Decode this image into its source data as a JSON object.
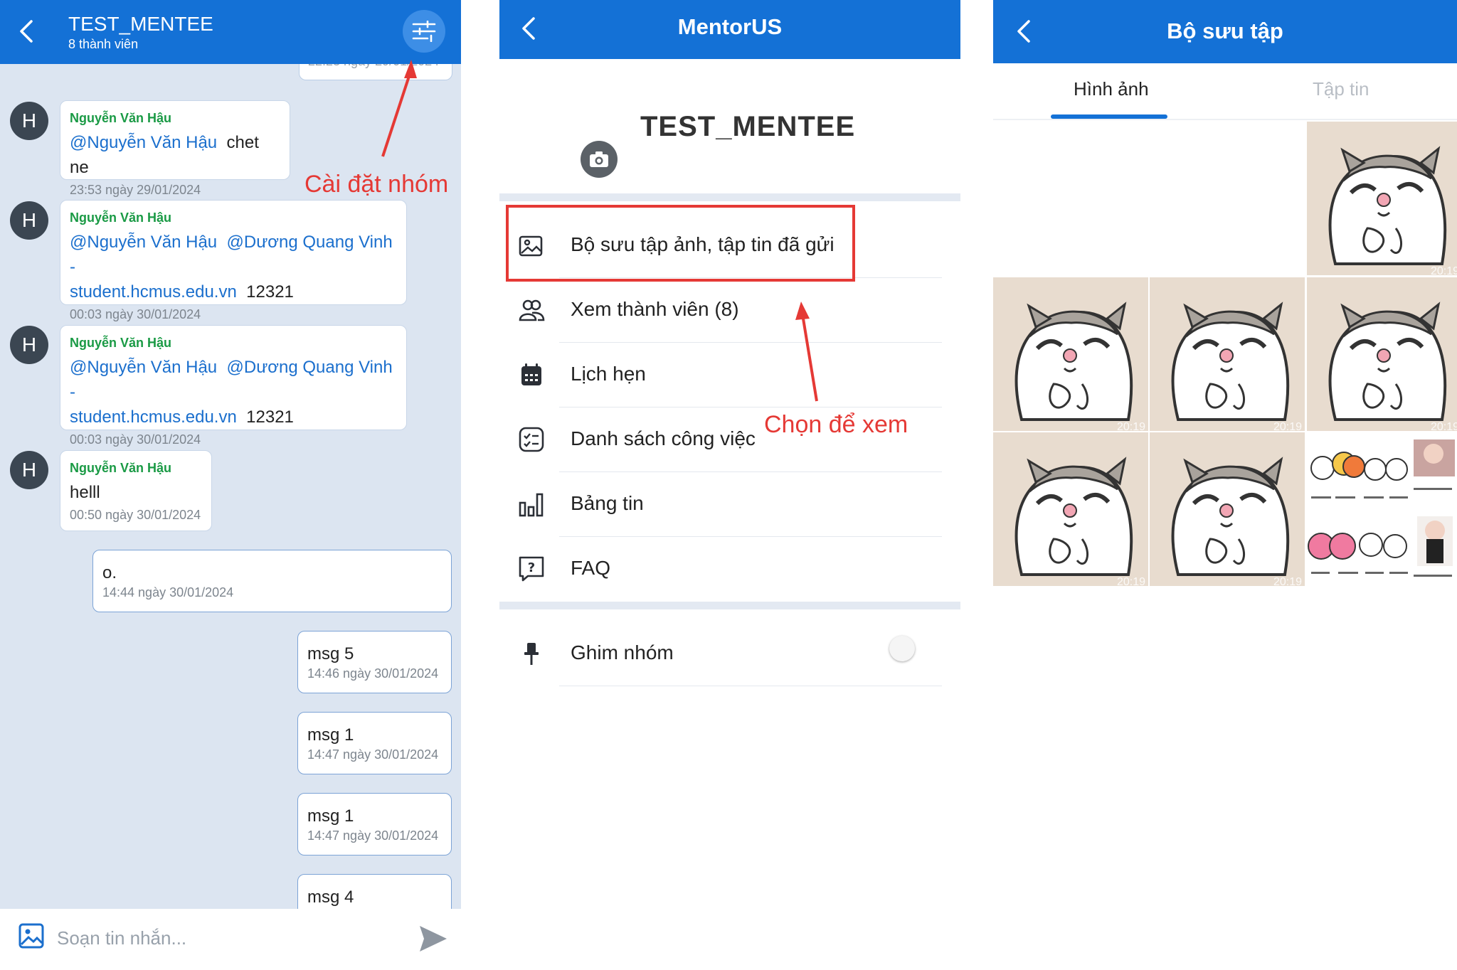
{
  "chat": {
    "group_title": "TEST_MENTEE",
    "member_count": "8 thành viên",
    "clipped_time": "22:23 ngày 29/01/2024",
    "messages": [
      {
        "avatar": "H",
        "sender": "Nguyễn Văn Hậu",
        "mention1": "@Nguyễn Văn Hậu",
        "text": "chet ne",
        "time": "23:53 ngày 29/01/2024"
      },
      {
        "avatar": "H",
        "sender": "Nguyễn Văn Hậu",
        "mention1": "@Nguyễn Văn Hậu",
        "mention2": "@Dương Quang Vinh -",
        "mention2b": "student.hcmus.edu.vn",
        "text": "12321",
        "time": "00:03 ngày 30/01/2024"
      },
      {
        "avatar": "H",
        "sender": "Nguyễn Văn Hậu",
        "mention1": "@Nguyễn Văn Hậu",
        "mention2": "@Dương Quang Vinh -",
        "mention2b": "student.hcmus.edu.vn",
        "text": "12321",
        "time": "00:03 ngày 30/01/2024"
      },
      {
        "avatar": "H",
        "sender": "Nguyễn Văn Hậu",
        "text": "helll",
        "time": "00:50 ngày 30/01/2024"
      }
    ],
    "my_messages": [
      {
        "text": "o.",
        "time": "14:44 ngày 30/01/2024"
      },
      {
        "text": "msg 5",
        "time": "14:46 ngày 30/01/2024"
      },
      {
        "text": "msg 1",
        "time": "14:47 ngày 30/01/2024"
      },
      {
        "text": "msg 1",
        "time": "14:47 ngày 30/01/2024"
      },
      {
        "text": "msg 4"
      }
    ],
    "composer_placeholder": "Soạn tin nhắn...",
    "annotation": "Cài đặt nhóm"
  },
  "settings": {
    "app_title": "MentorUS",
    "group_name": "TEST_MENTEE",
    "menu": [
      {
        "label": "Bộ sưu tập ảnh, tập tin đã gửi",
        "icon": "gallery-icon"
      },
      {
        "label": "Xem thành viên (8)",
        "icon": "members-icon"
      },
      {
        "label": "Lịch hẹn",
        "icon": "calendar-icon"
      },
      {
        "label": "Danh sách công việc",
        "icon": "task-list-icon"
      },
      {
        "label": "Bảng tin",
        "icon": "bar-chart-icon"
      },
      {
        "label": "FAQ",
        "icon": "faq-icon"
      }
    ],
    "pin": {
      "label": "Ghim nhóm",
      "enabled": false
    },
    "annotation": "Chọn để xem"
  },
  "gallery": {
    "title": "Bộ sưu tập",
    "tabs": [
      {
        "label": "Hình ảnh",
        "active": true
      },
      {
        "label": "Tập tin",
        "active": false
      }
    ],
    "timestamp_label": "20:19"
  },
  "colors": {
    "primary": "#1471d6",
    "annotation_red": "#e53935",
    "sender_green": "#1a9a45",
    "mention_blue": "#1b6fcd"
  }
}
